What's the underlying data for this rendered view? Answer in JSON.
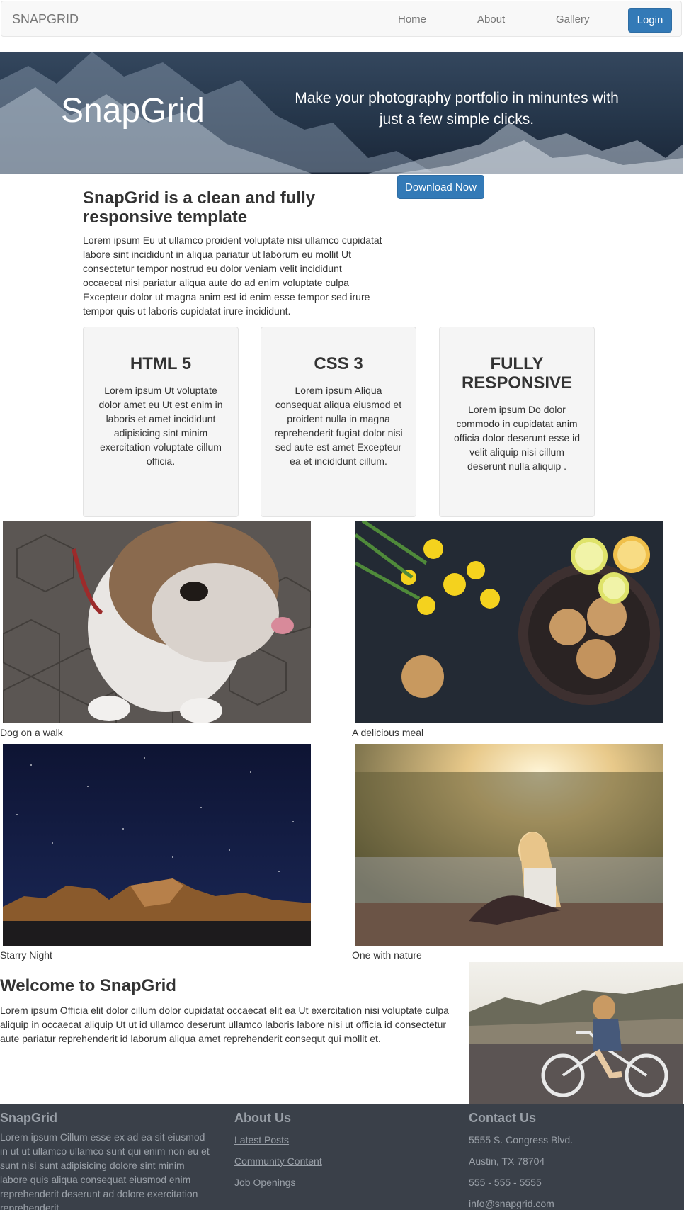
{
  "navbar": {
    "brand": "SNAPGRID",
    "links": [
      "Home",
      "About",
      "Gallery"
    ],
    "login": "Login"
  },
  "hero": {
    "title": "SnapGrid",
    "tagline": "Make your photography portfolio in minuntes with just a few simple clicks.",
    "download": "Download Now"
  },
  "intro": {
    "heading": "SnapGrid is a clean and fully responsive template",
    "body": "Lorem ipsum Eu ut ullamco proident voluptate nisi ullamco cupidatat labore sint incididunt in aliqua pariatur ut laborum eu mollit Ut consectetur tempor nostrud eu dolor veniam velit incididunt occaecat nisi pariatur aliqua aute do ad enim voluptate culpa Excepteur dolor ut magna anim est id enim esse tempor sed irure tempor quis ut laboris cupidatat irure incididunt."
  },
  "features": [
    {
      "title": "HTML 5",
      "body": "Lorem ipsum Ut voluptate dolor amet eu Ut est enim in laboris et amet incididunt adipisicing sint minim exercitation voluptate cillum officia."
    },
    {
      "title": "CSS 3",
      "body": "Lorem ipsum Aliqua consequat aliqua eiusmod et proident nulla in magna reprehenderit fugiat dolor nisi sed aute est amet Excepteur ea et incididunt cillum."
    },
    {
      "title": "FULLY RESPONSIVE",
      "body": "Lorem ipsum Do dolor commodo in cupidatat anim officia dolor deserunt esse id velit aliquip nisi cillum deserunt nulla aliquip ."
    }
  ],
  "gallery": [
    {
      "caption": "Dog on a walk"
    },
    {
      "caption": "A delicious meal"
    },
    {
      "caption": "Starry Night"
    },
    {
      "caption": "One with nature"
    }
  ],
  "welcome": {
    "heading": "Welcome to SnapGrid",
    "body": "Lorem ipsum Officia elit dolor cillum dolor cupidatat occaecat elit ea Ut exercitation nisi voluptate culpa aliquip in occaecat aliquip Ut ut id ullamco deserunt ullamco laboris labore nisi ut officia id consectetur aute pariatur reprehenderit id laborum aliqua amet reprehenderit consequt qui mollit et."
  },
  "footer": {
    "about": {
      "title": "SnapGrid",
      "text": "Lorem ipsum Cillum esse ex ad ea sit eiusmod in ut ut ullamco ullamco sunt qui enim non eu et sunt nisi sunt adipisicing dolore sint minim labore quis aliqua consequat eiusmod enim reprehenderit deserunt ad dolore exercitation reprehenderit."
    },
    "links": {
      "title": "About Us",
      "items": [
        "Latest Posts",
        "Community Content",
        "Job Openings"
      ]
    },
    "contact": {
      "title": "Contact Us",
      "address1": "5555 S. Congress Blvd.",
      "address2": "Austin, TX 78704",
      "phone": "555 - 555 - 5555",
      "email": "info@snapgrid.com"
    }
  }
}
